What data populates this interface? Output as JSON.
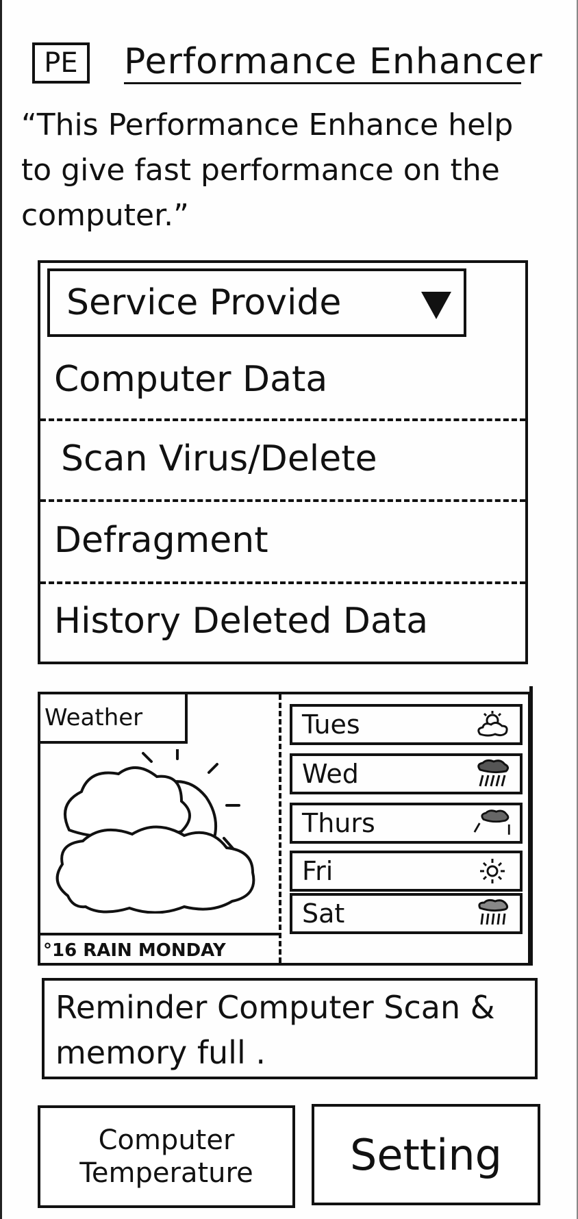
{
  "header": {
    "logo": "PE",
    "title": "Performance Enhancer",
    "tagline": "“This Performance Enhance help to give fast performance on the computer.”"
  },
  "services": {
    "dropdown_label": "Service Provide",
    "items": [
      {
        "label": "Computer Data"
      },
      {
        "label": "Scan Virus/Delete"
      },
      {
        "label": "Defragment"
      },
      {
        "label": "History Deleted Data"
      }
    ]
  },
  "weather": {
    "label": "Weather",
    "current_icon": "cloud-sun-icon",
    "caption": "°16 RAIN MONDAY",
    "forecast": [
      {
        "day": "Tues",
        "icon": "partly-cloudy-icon"
      },
      {
        "day": "Wed",
        "icon": "rain-icon"
      },
      {
        "day": "Thurs",
        "icon": "drizzle-icon"
      },
      {
        "day": "Fri",
        "icon": "sun-icon"
      },
      {
        "day": "Sat",
        "icon": "rain-icon"
      }
    ]
  },
  "reminder": {
    "text": "Reminder Computer Scan & memory full ."
  },
  "buttons": {
    "temperature": "Computer Temperature",
    "setting": "Setting"
  }
}
